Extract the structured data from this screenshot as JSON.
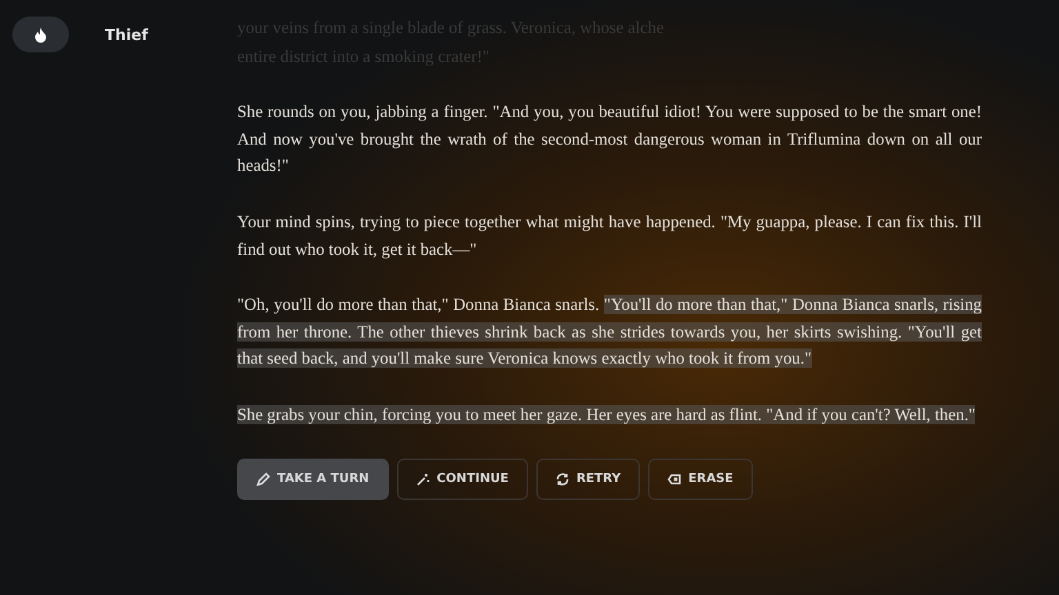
{
  "character": {
    "label": "Thief"
  },
  "story": [
    {
      "faded": true,
      "segments": [
        {
          "text": "your veins from a single blade of grass. Veronica, whose alche",
          "highlighted": false
        }
      ],
      "cut": true
    },
    {
      "faded": true,
      "segments": [
        {
          "text": "entire district into a smoking crater!\"",
          "highlighted": false
        }
      ],
      "cut": false
    },
    {
      "faded": false,
      "segments": [
        {
          "text": "She rounds on you, jabbing a finger. \"And you, you beautiful idiot! You were supposed to be the smart one! And now you've brought the wrath of the second-most dangerous woman in Triflumina down on all our heads!\"",
          "highlighted": false
        }
      ],
      "cut": false
    },
    {
      "faded": false,
      "segments": [
        {
          "text": "Your mind spins, trying to piece together what might have happened. \"My guappa, please. I can fix this. I'll find out who took it, get it back—\"",
          "highlighted": false
        }
      ],
      "cut": false
    },
    {
      "faded": false,
      "segments": [
        {
          "text": "\"Oh, you'll do more than that,\" Donna Bianca snarls. ",
          "highlighted": false
        },
        {
          "text": "\"You'll do more than that,\" Donna Bianca snarls, rising from her throne. The other thieves shrink back as she strides towards you, her skirts swishing. \"You'll get that seed back, and you'll make sure Veronica knows exactly who took it from you.\"",
          "highlighted": true
        }
      ],
      "cut": false
    },
    {
      "faded": false,
      "segments": [
        {
          "text": "She grabs your chin, forcing you to meet her gaze. Her eyes are hard as flint. \"And if you can't? Well, then.\"",
          "highlighted": true
        }
      ],
      "cut": false
    }
  ],
  "actions": [
    {
      "kind": "pen",
      "label": "TAKE A TURN",
      "selected": true
    },
    {
      "kind": "wand",
      "label": "CONTINUE",
      "selected": false
    },
    {
      "kind": "retry",
      "label": "RETRY",
      "selected": false
    },
    {
      "kind": "erase",
      "label": "ERASE",
      "selected": false
    }
  ]
}
